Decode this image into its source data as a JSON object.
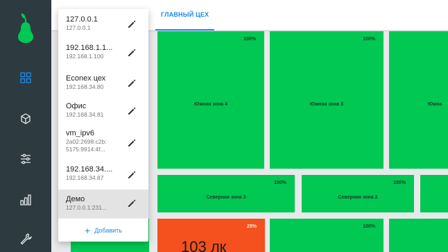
{
  "header": {
    "tab_label": "ГЛАВНЫЙ ЦЕХ"
  },
  "servers": [
    {
      "name": "127.0.0.1",
      "address": "127.0.0.1",
      "active": false
    },
    {
      "name": "192.168.1.1...",
      "address": "192.168.1.100",
      "active": false
    },
    {
      "name": "Econex цех",
      "address": "192.168.34.80",
      "active": false
    },
    {
      "name": "Офис",
      "address": "192.168.34.81",
      "active": false
    },
    {
      "name": "vm_ipv6",
      "address": "2a02:2698:c2b:",
      "address_line2": "5175:9914:4f...",
      "active": false
    },
    {
      "name": "192.168.34....",
      "address": "192.168.34.87",
      "active": false
    },
    {
      "name": "Демо",
      "address": "127.0.0.1:231...",
      "active": true
    }
  ],
  "add_label": "Добавить",
  "zones": [
    {
      "name": "Южная зона 4",
      "percent": "100%",
      "color": "#00c853"
    },
    {
      "name": "Южная зона 3",
      "percent": "100%",
      "color": "#00c853"
    },
    {
      "name": "Южна",
      "percent": "",
      "color": "#00c853"
    },
    {
      "name": "Северная зона 3",
      "percent": "100%",
      "color": "#00c853"
    },
    {
      "name": "Северная зона 2",
      "percent": "100%",
      "color": "#00c853"
    },
    {
      "name": "",
      "percent": "",
      "color": "#00c853"
    },
    {
      "name": "",
      "percent": "25%",
      "value": "103 лк",
      "color": "#f4511e"
    },
    {
      "name": "",
      "percent": "100%",
      "color": "#00c853"
    }
  ],
  "icons": {
    "logo": "pear-logo",
    "nav": [
      "dashboard-grid-icon",
      "cube-icon",
      "sliders-icon",
      "bar-chart-icon",
      "wrench-icon"
    ],
    "edit": "pencil-icon"
  },
  "colors": {
    "accent": "#1e88e5",
    "rail": "#2d3a3f",
    "ok": "#00c853",
    "alert": "#f4511e"
  }
}
